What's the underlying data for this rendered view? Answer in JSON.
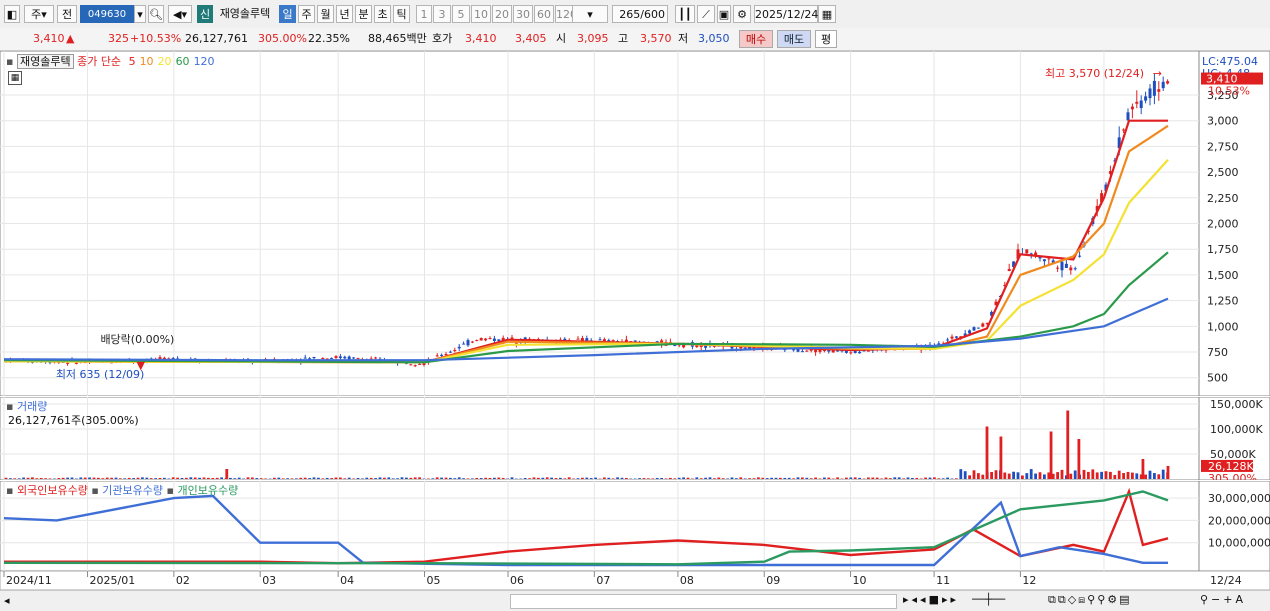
{
  "toolbar": {
    "market_label": "주",
    "prev_label": "전",
    "stock_code": "049630",
    "new_badge": "신",
    "stock_name": "재영솔루텍",
    "period_tabs": [
      "일",
      "주",
      "월",
      "년",
      "분",
      "초",
      "틱"
    ],
    "active_period": "일",
    "interval_buttons": [
      "1",
      "3",
      "5",
      "10",
      "20",
      "30",
      "60",
      "120"
    ],
    "bar_count": "265",
    "bar_total": "/600",
    "date": "2025/12/24"
  },
  "quote": {
    "price": "3,410",
    "direction": "▲",
    "change": "325",
    "change_pct": "+10.53%",
    "volume": "26,127,761",
    "volume_ratio": "305.00%",
    "turnover": "22.35%",
    "amount": "88,465백만",
    "hoga_label": "호가",
    "ask": "3,410",
    "bid": "3,405",
    "open_label": "시",
    "open": "3,095",
    "high_label": "고",
    "high": "3,570",
    "low_label": "저",
    "low": "3,050",
    "buy_label": "매수",
    "sell_label": "매도",
    "avg_label": "평"
  },
  "price_pane": {
    "stock_name": "재영솔루텍",
    "ma_title": "종가 단순",
    "ma_periods": [
      "5",
      "10",
      "20",
      "60",
      "120"
    ],
    "high_annotation": "최고 3,570 (12/24)",
    "low_annotation": "최저 635 (12/09)",
    "dividend_annotation": "배당락(0.00%)",
    "lc_label": "LC:475.04",
    "hc_label": "HC:-4.48",
    "last_price_tag": "3,410",
    "last_pct_tag": "10.53%"
  },
  "volume_pane": {
    "title": "거래량",
    "current": "26,127,761주(305.00%)",
    "last_tag": "26,128K",
    "last_pct_tag": "305.00%"
  },
  "holdings_pane": {
    "titles": [
      "외국인보유수량",
      "기관보유수량",
      "개인보유수량"
    ]
  },
  "colors": {
    "up": "#e02020",
    "down": "#1f4fbf",
    "ma5": "#e02020",
    "ma10": "#f08a1e",
    "ma20": "#f5e132",
    "ma60": "#2a9a4a",
    "ma120": "#3f6fd6",
    "foreign": "#e02020",
    "institution": "#3f6fd6",
    "individual": "#2a9a60"
  },
  "chart_data": [
    {
      "type": "line",
      "title": "재영솔루텍",
      "x_axis_labels": [
        "2024/11",
        "2025/01",
        "02",
        "03",
        "04",
        "05",
        "06",
        "07",
        "08",
        "09",
        "10",
        "11",
        "12",
        "12/24"
      ],
      "y_tick_labels": [
        "500",
        "750",
        "1,000",
        "1,250",
        "1,500",
        "1,750",
        "2,000",
        "2,250",
        "2,500",
        "2,750",
        "3,000",
        "3,250"
      ],
      "ylim": [
        400,
        3600
      ],
      "series": [
        {
          "name": "종가",
          "x": [
            "2024/11",
            "2024/12",
            "2025/01",
            "2025/02",
            "2025/03",
            "2025/04",
            "2025/04/20",
            "2025/05",
            "2025/06",
            "2025/07",
            "2025/08",
            "2025/09",
            "2025/10",
            "2025/10/20",
            "2025/11",
            "2025/11/20",
            "2025/12",
            "2025/12/10",
            "2025/12/24"
          ],
          "values": [
            670,
            650,
            680,
            660,
            700,
            640,
            880,
            870,
            860,
            830,
            790,
            760,
            800,
            1030,
            1750,
            1550,
            2300,
            3100,
            3410
          ]
        },
        {
          "name": "5",
          "x": [
            "2024/11",
            "2025/04",
            "2025/05",
            "2025/07",
            "2025/09",
            "2025/10",
            "2025/10/20",
            "2025/11",
            "2025/11/20",
            "2025/12",
            "2025/12/10",
            "2025/12/24"
          ],
          "values": [
            660,
            650,
            870,
            830,
            770,
            790,
            980,
            1700,
            1650,
            2250,
            3000,
            3000
          ]
        },
        {
          "name": "10",
          "x": [
            "2024/11",
            "2025/04",
            "2025/05",
            "2025/07",
            "2025/09",
            "2025/10",
            "2025/10/20",
            "2025/11",
            "2025/11/20",
            "2025/12",
            "2025/12/10",
            "2025/12/24"
          ],
          "values": [
            660,
            650,
            850,
            830,
            780,
            780,
            900,
            1500,
            1680,
            2000,
            2700,
            2950
          ]
        },
        {
          "name": "20",
          "x": [
            "2024/11",
            "2025/04",
            "2025/05",
            "2025/07",
            "2025/09",
            "2025/10",
            "2025/10/20",
            "2025/11",
            "2025/11/20",
            "2025/12",
            "2025/12/10",
            "2025/12/24"
          ],
          "values": [
            660,
            650,
            820,
            830,
            790,
            780,
            860,
            1200,
            1450,
            1700,
            2200,
            2620
          ]
        },
        {
          "name": "60",
          "x": [
            "2024/11",
            "2025/04",
            "2025/05",
            "2025/07",
            "2025/09",
            "2025/10",
            "2025/11",
            "2025/11/20",
            "2025/12",
            "2025/12/10",
            "2025/12/24"
          ],
          "values": [
            670,
            650,
            760,
            830,
            820,
            800,
            900,
            1000,
            1120,
            1400,
            1720
          ]
        },
        {
          "name": "120",
          "x": [
            "2024/11",
            "2025/02",
            "2025/04",
            "2025/06",
            "2025/08",
            "2025/10",
            "2025/11",
            "2025/12",
            "2025/12/24"
          ],
          "values": [
            680,
            670,
            670,
            720,
            780,
            810,
            880,
            1000,
            1270
          ]
        }
      ]
    },
    {
      "type": "bar",
      "title": "거래량",
      "y_tick_labels": [
        "50,000K",
        "100,000K",
        "150,000K"
      ],
      "ylim": [
        0,
        160000
      ],
      "spikes": [
        {
          "x": "2025/01/20",
          "value": 20000
        },
        {
          "x": "2025/10/20",
          "value": 105000
        },
        {
          "x": "2025/10/25",
          "value": 85000
        },
        {
          "x": "2025/11/12",
          "value": 95000
        },
        {
          "x": "2025/11/18",
          "value": 137000
        },
        {
          "x": "2025/11/22",
          "value": 80000
        },
        {
          "x": "2025/12/15",
          "value": 40000
        },
        {
          "x": "2025/12/24",
          "value": 26128
        }
      ]
    },
    {
      "type": "line",
      "title": "보유수량",
      "y_tick_labels": [
        "10,000,000",
        "20,000,000",
        "30,000,000"
      ],
      "ylim": [
        0,
        35000000
      ],
      "series": [
        {
          "name": "외국인보유수량",
          "x": [
            "2024/11",
            "2025/02",
            "2025/03",
            "2025/04",
            "2025/05",
            "2025/06",
            "2025/07",
            "2025/08",
            "2025/09",
            "2025/10",
            "2025/10/15",
            "2025/11",
            "2025/11/20",
            "2025/12",
            "2025/12/10",
            "2025/12/15",
            "2025/12/24"
          ],
          "values": [
            1500000,
            1500000,
            800000,
            1500000,
            6000000,
            9000000,
            11000000,
            9000000,
            4500000,
            7000000,
            16000000,
            4000000,
            9000000,
            6000000,
            33000000,
            9000000,
            12000000
          ]
        },
        {
          "name": "기관보유수량",
          "x": [
            "2024/11",
            "2024/11/20",
            "2025/01",
            "2025/01/15",
            "2025/02",
            "2025/03",
            "2025/03/10",
            "2025/05",
            "2025/09",
            "2025/10",
            "2025/10/25",
            "2025/11",
            "2025/11/15",
            "2025/12",
            "2025/12/15",
            "2025/12/24"
          ],
          "values": [
            21000000,
            20000000,
            30000000,
            31000000,
            10000000,
            10000000,
            1000000,
            0,
            0,
            0,
            28000000,
            4000000,
            8000000,
            5000000,
            1000000,
            1000000
          ]
        },
        {
          "name": "개인보유수량",
          "x": [
            "2024/11",
            "2025/04",
            "2025/07",
            "2025/08",
            "2025/08/10",
            "2025/09",
            "2025/10",
            "2025/11",
            "2025/12",
            "2025/12/15",
            "2025/12/24"
          ],
          "values": [
            1000000,
            800000,
            300000,
            1500000,
            6000000,
            6500000,
            8000000,
            25000000,
            29000000,
            33000000,
            29000000
          ]
        }
      ]
    }
  ]
}
